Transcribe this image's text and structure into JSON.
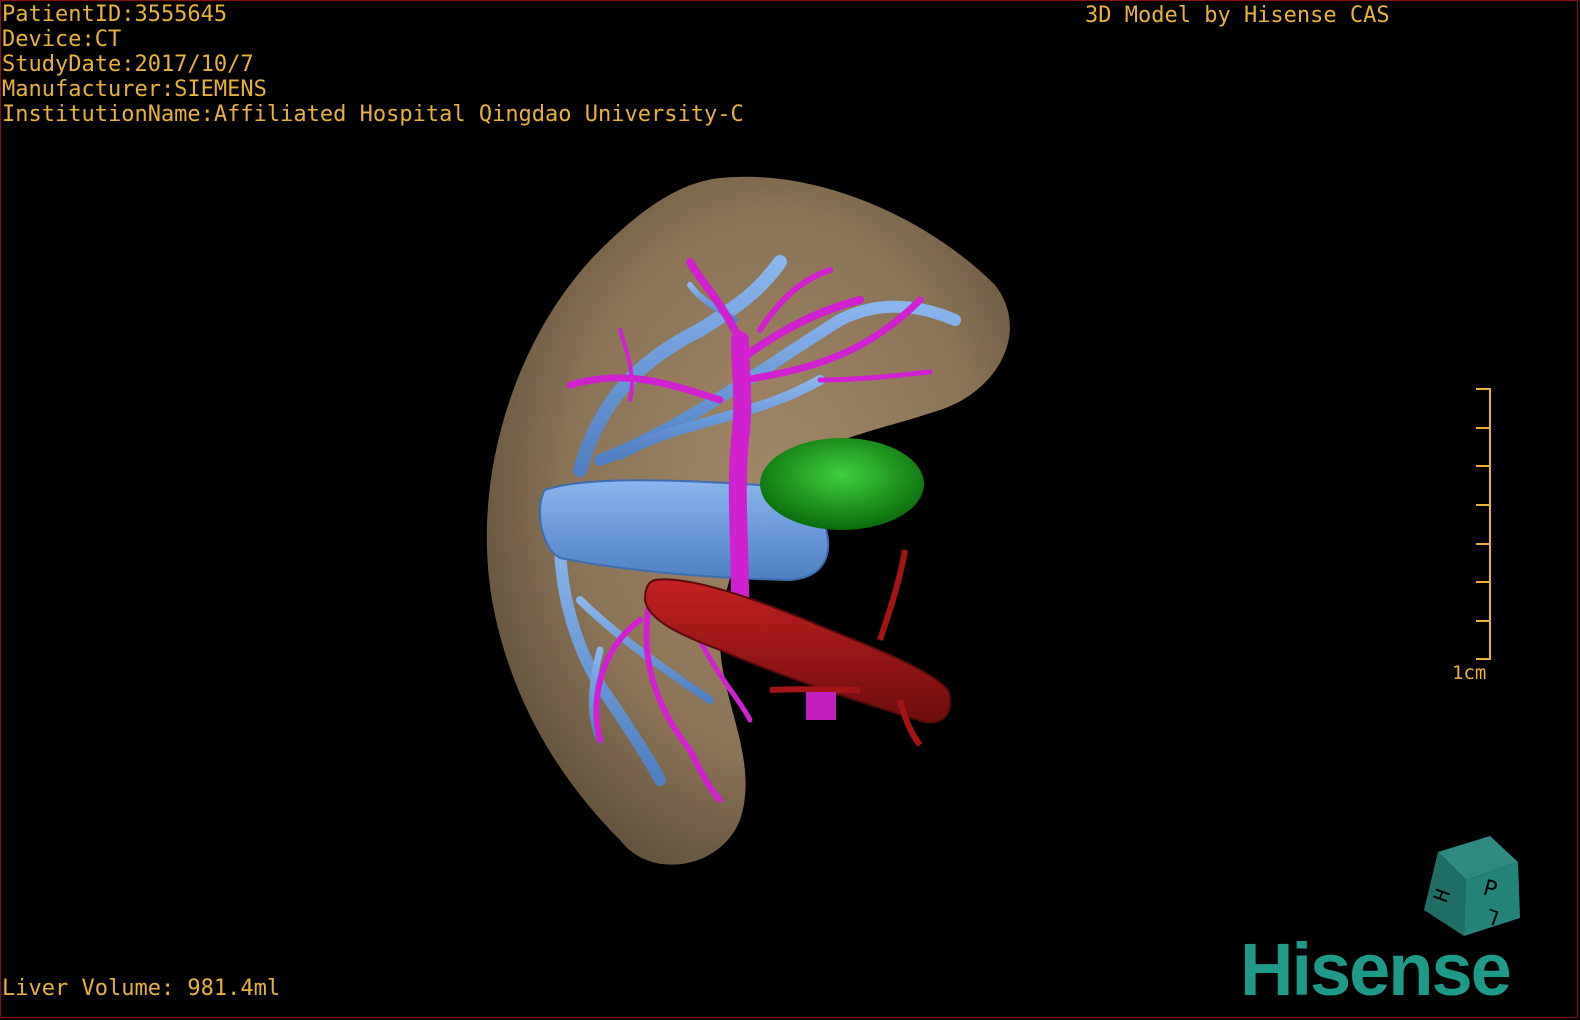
{
  "overlay": {
    "patient_id": "PatientID:3555645",
    "device": "Device:CT",
    "study_date": "StudyDate:2017/10/7",
    "manufacturer": "Manufacturer:SIEMENS",
    "institution": "InstitutionName:Affiliated Hospital Qingdao University-C",
    "model_by": "3D Model by Hisense CAS",
    "liver_volume": "Liver Volume: 981.4ml"
  },
  "scale": {
    "label": "1cm"
  },
  "orientation_cube": {
    "letters": [
      "P",
      "H",
      "L"
    ]
  },
  "brand": {
    "logo_text": "Hisense"
  },
  "colors": {
    "overlay_text": "#e8b23a",
    "liver": "#8b7456",
    "portal_vein": "#d020d0",
    "hepatic_vein": "#6a9ad8",
    "artery": "#a31515",
    "tumor": "#1fa11f",
    "brand": "#1e9a88",
    "border": "#8a1010"
  },
  "icons": {
    "cube": "orientation-cube-icon",
    "scale": "scale-bar-icon"
  }
}
